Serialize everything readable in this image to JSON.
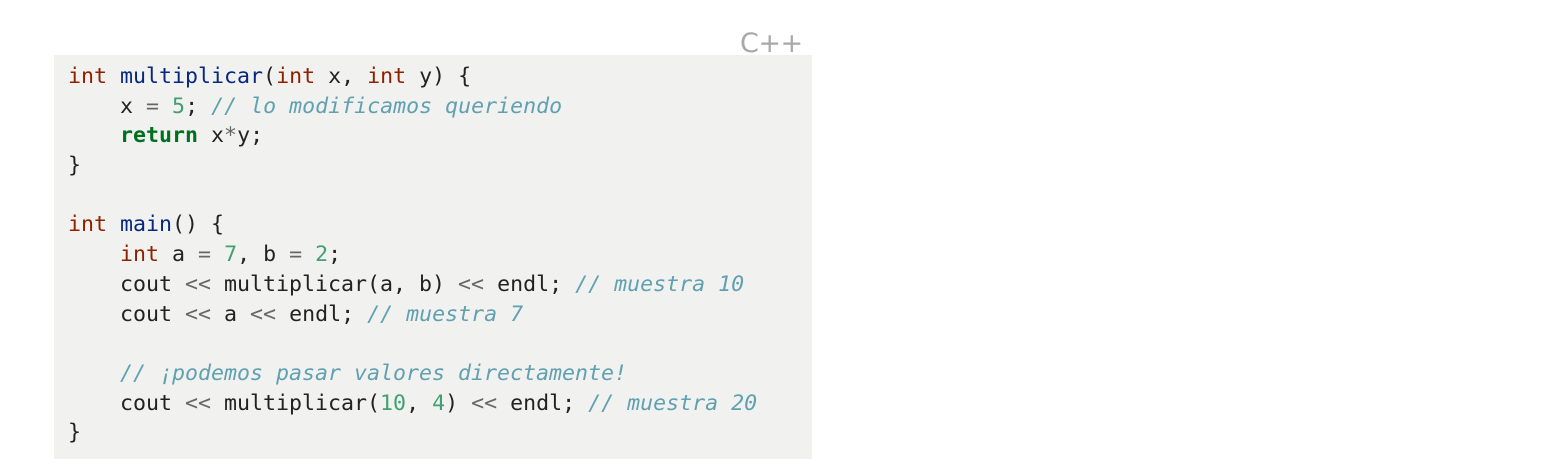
{
  "language_label": "C++",
  "colors": {
    "background": "#f1f2f0",
    "type": "#902000",
    "function": "#06287e",
    "keyword": "#007020",
    "number": "#40a070",
    "operator": "#666666",
    "comment": "#60a0b0",
    "plain": "#222222",
    "label": "#a8a8a8"
  },
  "code": {
    "lines": [
      [
        {
          "t": "type",
          "v": "int"
        },
        {
          "t": "plain",
          "v": " "
        },
        {
          "t": "fn",
          "v": "multiplicar"
        },
        {
          "t": "plain",
          "v": "("
        },
        {
          "t": "type",
          "v": "int"
        },
        {
          "t": "plain",
          "v": " x, "
        },
        {
          "t": "type",
          "v": "int"
        },
        {
          "t": "plain",
          "v": " y) {"
        }
      ],
      [
        {
          "t": "plain",
          "v": "    x "
        },
        {
          "t": "op",
          "v": "="
        },
        {
          "t": "plain",
          "v": " "
        },
        {
          "t": "num",
          "v": "5"
        },
        {
          "t": "plain",
          "v": "; "
        },
        {
          "t": "com",
          "v": "// lo modificamos queriendo"
        }
      ],
      [
        {
          "t": "plain",
          "v": "    "
        },
        {
          "t": "kw",
          "v": "return"
        },
        {
          "t": "plain",
          "v": " x"
        },
        {
          "t": "op",
          "v": "*"
        },
        {
          "t": "plain",
          "v": "y;"
        }
      ],
      [
        {
          "t": "plain",
          "v": "}"
        }
      ],
      [],
      [
        {
          "t": "type",
          "v": "int"
        },
        {
          "t": "plain",
          "v": " "
        },
        {
          "t": "fn",
          "v": "main"
        },
        {
          "t": "plain",
          "v": "() {"
        }
      ],
      [
        {
          "t": "plain",
          "v": "    "
        },
        {
          "t": "type",
          "v": "int"
        },
        {
          "t": "plain",
          "v": " a "
        },
        {
          "t": "op",
          "v": "="
        },
        {
          "t": "plain",
          "v": " "
        },
        {
          "t": "num",
          "v": "7"
        },
        {
          "t": "plain",
          "v": ", b "
        },
        {
          "t": "op",
          "v": "="
        },
        {
          "t": "plain",
          "v": " "
        },
        {
          "t": "num",
          "v": "2"
        },
        {
          "t": "plain",
          "v": ";"
        }
      ],
      [
        {
          "t": "plain",
          "v": "    cout "
        },
        {
          "t": "op",
          "v": "<<"
        },
        {
          "t": "plain",
          "v": " multiplicar(a, b) "
        },
        {
          "t": "op",
          "v": "<<"
        },
        {
          "t": "plain",
          "v": " endl; "
        },
        {
          "t": "com",
          "v": "// muestra 10"
        }
      ],
      [
        {
          "t": "plain",
          "v": "    cout "
        },
        {
          "t": "op",
          "v": "<<"
        },
        {
          "t": "plain",
          "v": " a "
        },
        {
          "t": "op",
          "v": "<<"
        },
        {
          "t": "plain",
          "v": " endl; "
        },
        {
          "t": "com",
          "v": "// muestra 7"
        }
      ],
      [],
      [
        {
          "t": "plain",
          "v": "    "
        },
        {
          "t": "com",
          "v": "// ¡podemos pasar valores directamente!"
        }
      ],
      [
        {
          "t": "plain",
          "v": "    cout "
        },
        {
          "t": "op",
          "v": "<<"
        },
        {
          "t": "plain",
          "v": " multiplicar("
        },
        {
          "t": "num",
          "v": "10"
        },
        {
          "t": "plain",
          "v": ", "
        },
        {
          "t": "num",
          "v": "4"
        },
        {
          "t": "plain",
          "v": ") "
        },
        {
          "t": "op",
          "v": "<<"
        },
        {
          "t": "plain",
          "v": " endl; "
        },
        {
          "t": "com",
          "v": "// muestra 20"
        }
      ],
      [
        {
          "t": "plain",
          "v": "}"
        }
      ]
    ]
  }
}
